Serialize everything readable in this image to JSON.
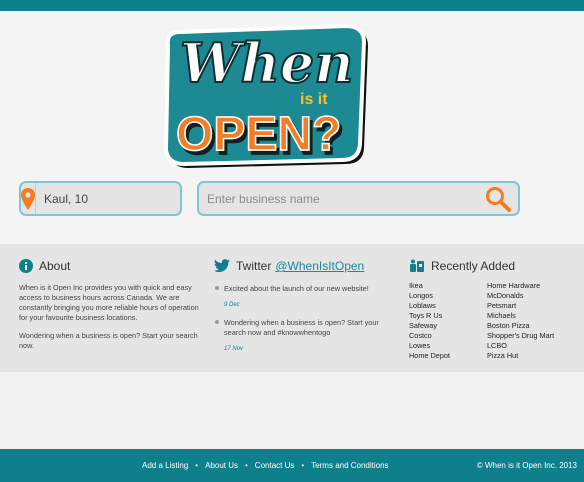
{
  "logo": {
    "word1": "When",
    "word2": "is it",
    "word3": "OPEN?"
  },
  "search": {
    "location_value": "Kaul, 10",
    "business_placeholder": "Enter business name"
  },
  "about": {
    "title": "About",
    "para1": "When is it Open Inc provides you with quick and easy access to business hours across Canada. We are constantly bringing you more reliable hours of operation for your favourite business locations.",
    "para2": "Wondering when a business is open? Start your search now."
  },
  "twitter": {
    "title": "Twitter",
    "handle": "@WhenIsItOpen",
    "tweets": [
      {
        "text": "Excited about the launch of our new website!",
        "date": "9 Dec"
      },
      {
        "text": "Wondering when a business is open? Start your search now and #knowwhentogo",
        "date": "17 Nov"
      }
    ]
  },
  "recent": {
    "title": "Recently Added",
    "col1": [
      "Ikea",
      "Longos",
      "Loblaws",
      "Toys R Us",
      "Safeway",
      "Costco",
      "Lowes",
      "Home Depot"
    ],
    "col2": [
      "Home Hardware",
      "McDonalds",
      "Petsmart",
      "Michaels",
      "Boston Pizza",
      "Shopper's Drug Mart",
      "LCBO",
      "Pizza Hut"
    ]
  },
  "footer": {
    "links": [
      "Add a Listing",
      "About Us",
      "Contact Us",
      "Terms and Conditions"
    ],
    "separator": "•",
    "copyright": "© When is it Open Inc. 2013"
  },
  "colors": {
    "teal": "#0f7f8c",
    "orange": "#f47b20",
    "accent_blue": "#1a8a99"
  }
}
